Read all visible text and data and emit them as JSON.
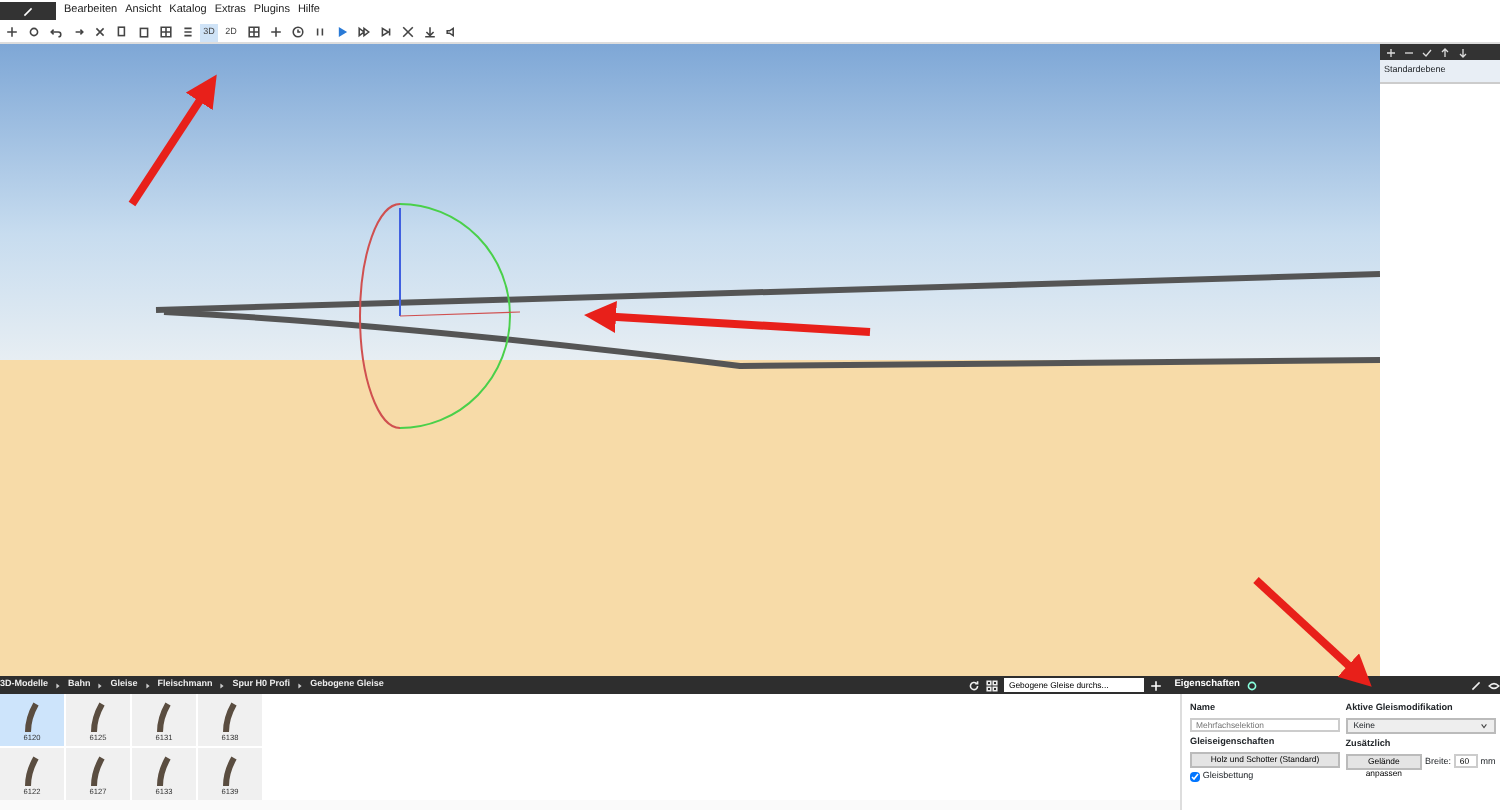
{
  "menu": {
    "items": [
      "Bearbeiten",
      "Ansicht",
      "Katalog",
      "Extras",
      "Plugins",
      "Hilfe"
    ]
  },
  "toolbar": {
    "view_modes": [
      {
        "label": "3D",
        "selected": true
      },
      {
        "label": "2D",
        "selected": false
      }
    ]
  },
  "layers": {
    "items": [
      {
        "name": "Standardebene",
        "selected": true
      }
    ]
  },
  "catalog": {
    "breadcrumb": [
      "3D-Modelle",
      "Bahn",
      "Gleise",
      "Fleischmann",
      "Spur H0 Profi",
      "Gebogene Gleise"
    ],
    "search": {
      "value": "Gebogene Gleise durchs..."
    },
    "tiles": [
      {
        "label": "6120",
        "selected": true
      },
      {
        "label": "6125",
        "selected": false
      },
      {
        "label": "6131",
        "selected": false
      },
      {
        "label": "6138",
        "selected": false
      },
      {
        "label": "6122",
        "selected": false
      },
      {
        "label": "6127",
        "selected": false
      },
      {
        "label": "6133",
        "selected": false
      },
      {
        "label": "6139",
        "selected": false
      }
    ]
  },
  "properties": {
    "tab": "Eigenschaften",
    "name_label": "Name",
    "name_placeholder": "Mehrfachselektion",
    "track_props_label": "Gleiseigenschaften",
    "track_props_button": "Holz und Schotter (Standard)",
    "bedding": {
      "label": "Gleisbettung",
      "checked": true
    },
    "modification_label": "Aktive Gleismodifikation",
    "modification_value": "Keine",
    "extra_label": "Zusätzlich",
    "terrain_button": "Gelände anpassen",
    "width_label": "Breite:",
    "width_value": "60",
    "width_unit": "mm"
  }
}
